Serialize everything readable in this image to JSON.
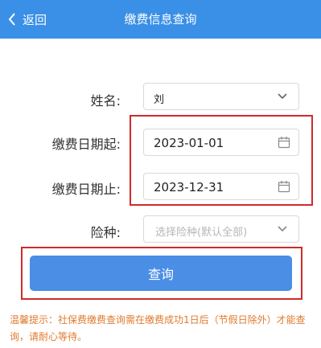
{
  "header": {
    "back_label": "返回",
    "title": "缴费信息查询"
  },
  "form": {
    "name_label": "姓名:",
    "name_value": "刘",
    "start_label": "缴费日期起:",
    "start_value": "2023-01-01",
    "end_label": "缴费日期止:",
    "end_value": "2023-12-31",
    "insurance_label": "险种:",
    "insurance_placeholder": "选择险种(默认全部)"
  },
  "query_button": "查询",
  "tip": "温馨提示：社保费缴费查询需在缴费成功1日后（节假日除外）才能查询，请耐心等待。",
  "colors": {
    "header_bg": "#3a8fe6",
    "button_bg": "#4a8ee6",
    "highlight": "#cf2b2b",
    "tip_text": "#e07a2e"
  }
}
